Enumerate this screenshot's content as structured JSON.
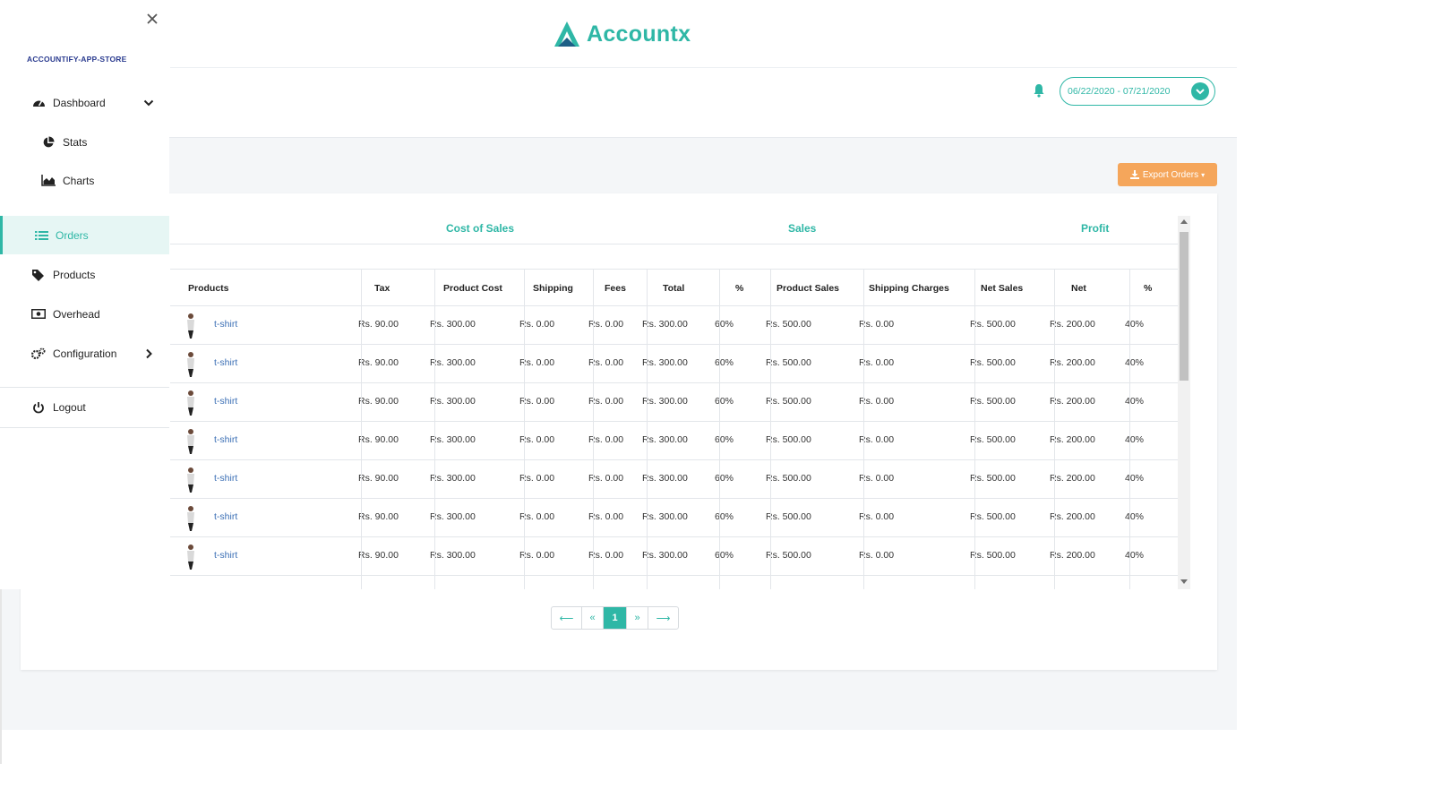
{
  "app": {
    "brand": "Accountx",
    "store_name": "ACCOUNTIFY-APP-STORE",
    "date_range": "06/22/2020 - 07/21/2020",
    "export_label": "Export Orders",
    "accent_color": "#2fb7a6",
    "export_color": "#f5a65b"
  },
  "sidebar": {
    "items": [
      {
        "label": "Dashboard",
        "icon": "dashboard-icon"
      },
      {
        "label": "Stats",
        "icon": "pie-chart-icon"
      },
      {
        "label": "Charts",
        "icon": "area-chart-icon"
      },
      {
        "label": "Orders",
        "icon": "list-icon",
        "active": true
      },
      {
        "label": "Products",
        "icon": "tags-icon"
      },
      {
        "label": "Overhead",
        "icon": "money-icon"
      },
      {
        "label": "Configuration",
        "icon": "cogs-icon"
      },
      {
        "label": "Logout",
        "icon": "power-icon"
      }
    ]
  },
  "table": {
    "groups": [
      "Cost of Sales",
      "Sales",
      "Profit"
    ],
    "headers": [
      "Products",
      "Tax",
      "Product Cost",
      "Shipping",
      "Fees",
      "Total",
      "%",
      "Product Sales",
      "Shipping Charges",
      "Net Sales",
      "Net",
      "%"
    ],
    "rows": [
      [
        "t-shirt",
        "Rs. 90.00",
        "Rs. 300.00",
        "Rs. 0.00",
        "Rs. 0.00",
        "Rs. 300.00",
        "60%",
        "Rs. 500.00",
        "Rs. 0.00",
        "Rs. 500.00",
        "Rs. 200.00",
        "40%"
      ],
      [
        "t-shirt",
        "Rs. 90.00",
        "Rs. 300.00",
        "Rs. 0.00",
        "Rs. 0.00",
        "Rs. 300.00",
        "60%",
        "Rs. 500.00",
        "Rs. 0.00",
        "Rs. 500.00",
        "Rs. 200.00",
        "40%"
      ],
      [
        "t-shirt",
        "Rs. 90.00",
        "Rs. 300.00",
        "Rs. 0.00",
        "Rs. 0.00",
        "Rs. 300.00",
        "60%",
        "Rs. 500.00",
        "Rs. 0.00",
        "Rs. 500.00",
        "Rs. 200.00",
        "40%"
      ],
      [
        "t-shirt",
        "Rs. 90.00",
        "Rs. 300.00",
        "Rs. 0.00",
        "Rs. 0.00",
        "Rs. 300.00",
        "60%",
        "Rs. 500.00",
        "Rs. 0.00",
        "Rs. 500.00",
        "Rs. 200.00",
        "40%"
      ],
      [
        "t-shirt",
        "Rs. 90.00",
        "Rs. 300.00",
        "Rs. 0.00",
        "Rs. 0.00",
        "Rs. 300.00",
        "60%",
        "Rs. 500.00",
        "Rs. 0.00",
        "Rs. 500.00",
        "Rs. 200.00",
        "40%"
      ],
      [
        "t-shirt",
        "Rs. 90.00",
        "Rs. 300.00",
        "Rs. 0.00",
        "Rs. 0.00",
        "Rs. 300.00",
        "60%",
        "Rs. 500.00",
        "Rs. 0.00",
        "Rs. 500.00",
        "Rs. 200.00",
        "40%"
      ],
      [
        "t-shirt",
        "Rs. 90.00",
        "Rs. 300.00",
        "Rs. 0.00",
        "Rs. 0.00",
        "Rs. 300.00",
        "60%",
        "Rs. 500.00",
        "Rs. 0.00",
        "Rs. 500.00",
        "Rs. 200.00",
        "40%"
      ]
    ]
  },
  "pagination": {
    "first": "⟵",
    "prev": "«",
    "current": "1",
    "next": "»",
    "last": "⟶"
  }
}
